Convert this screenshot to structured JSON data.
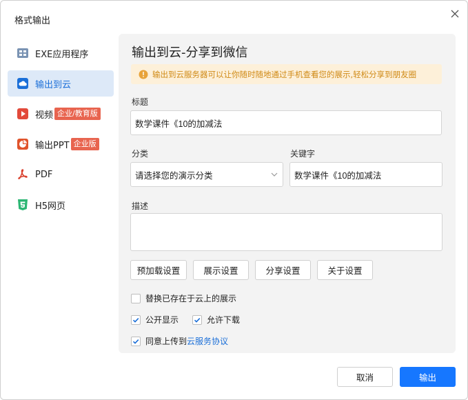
{
  "dialog": {
    "title": "格式输出",
    "close_icon": "close-icon"
  },
  "sidebar": {
    "items": [
      {
        "label": "EXE应用程序",
        "icon": "exe-icon",
        "color": "#7a93b3"
      },
      {
        "label": "输出到云",
        "icon": "cloud-icon",
        "color": "#1b6fd8"
      },
      {
        "label": "视频",
        "icon": "video-icon",
        "badge": "企业/教育版",
        "color": "#e24a3b"
      },
      {
        "label": "输出PPT",
        "icon": "ppt-icon",
        "badge": "企业版",
        "color": "#e0532b"
      },
      {
        "label": "PDF",
        "icon": "pdf-icon",
        "color": "#d9412e"
      },
      {
        "label": "H5网页",
        "icon": "html5-icon",
        "color": "#2bb673"
      }
    ],
    "active_index": 1
  },
  "panel": {
    "heading": "输出到云-分享到微信",
    "notice": "输出到云服务器可以让你随时随地通过手机查看您的展示,轻松分享到朋友圈",
    "notice_icon": "info-icon",
    "title_label": "标题",
    "title_value": "数学课件《10的加减法",
    "category_label": "分类",
    "category_value": "请选择您的演示分类",
    "keyword_label": "关键字",
    "keyword_value": "数学课件《10的加减法",
    "description_label": "描述",
    "description_value": "",
    "buttons": [
      "预加载设置",
      "展示设置",
      "分享设置",
      "关于设置"
    ],
    "options": {
      "replace_label": "替换已存在于云上的展示",
      "replace_checked": false,
      "public_label": "公开显示",
      "public_checked": true,
      "download_label": "允许下载",
      "download_checked": true,
      "agree_prefix": "同意上传到",
      "agree_link": "云服务协议",
      "agree_checked": true
    }
  },
  "footer": {
    "cancel": "取消",
    "export": "输出"
  },
  "colors": {
    "accent": "#1677ff",
    "notice_bg": "#fdf0d9",
    "notice_text": "#d08a16",
    "badge": "#e8644f",
    "active_bg": "#dde9f8"
  }
}
